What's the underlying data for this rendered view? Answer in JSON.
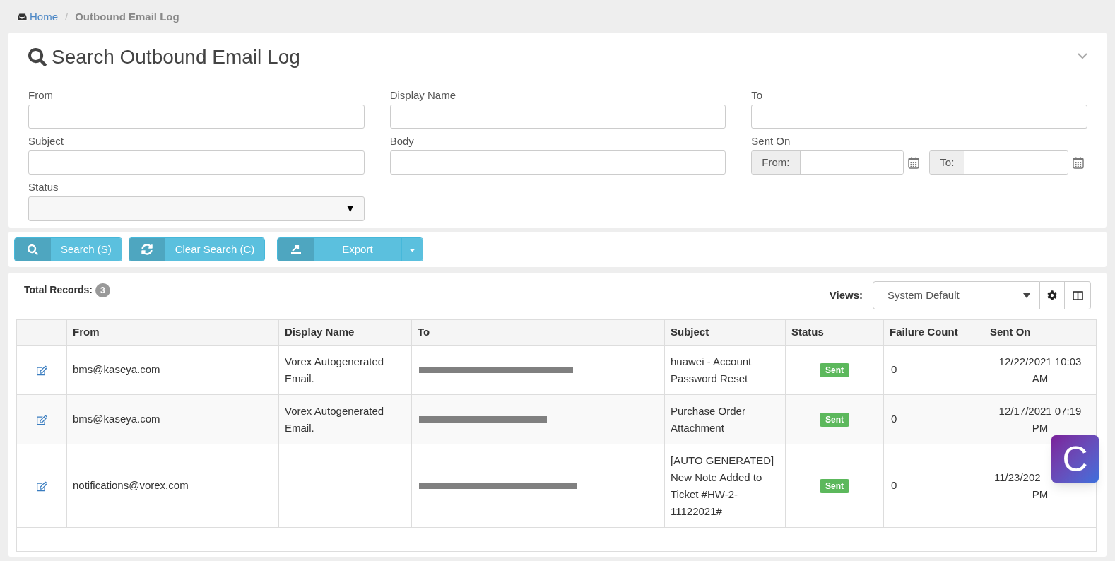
{
  "breadcrumb": [
    {
      "label": "Home",
      "kind": "link"
    },
    {
      "label": "Outbound Email Log",
      "kind": "current"
    }
  ],
  "breadcrumb_separator": "/",
  "status_caret": "▼",
  "search_panel": {
    "title": "Search Outbound Email Log",
    "fields": [
      {
        "label": "From",
        "kind": "text"
      },
      {
        "label": "Display Name",
        "kind": "text"
      },
      {
        "label": "To",
        "kind": "text"
      },
      {
        "label": "Subject",
        "kind": "text"
      },
      {
        "label": "Body",
        "kind": "text"
      },
      {
        "label": "Sent On",
        "kind": "date_range",
        "from_label": "From:",
        "to_label": "To:"
      },
      {
        "label": "Status",
        "kind": "select"
      }
    ]
  },
  "actions": [
    {
      "label": "Search (S)",
      "kind": "search"
    },
    {
      "label": "Clear Search (C)",
      "kind": "clear"
    },
    {
      "label": "Export",
      "kind": "export"
    }
  ],
  "results": {
    "total_label": "Total Records:",
    "total_count": "3",
    "views_label": "Views:",
    "view": "System Default",
    "columns": [
      "From",
      "Display Name",
      "To",
      "Subject",
      "Status",
      "Failure Count",
      "Sent On"
    ],
    "rows": [
      {
        "from": "bms@kaseya.com",
        "display_name": "Vorex Autogenerated Email.",
        "subject": "huawei - Account Password Reset",
        "status": "Sent",
        "failure_count": "0",
        "sent_on": [
          "12/22/2021 10:03",
          "AM"
        ]
      },
      {
        "from": "bms@kaseya.com",
        "display_name": "Vorex Autogenerated Email.",
        "subject": "Purchase Order Attachment",
        "status": "Sent",
        "failure_count": "0",
        "sent_on": [
          "12/17/2021 07:19",
          "PM"
        ]
      },
      {
        "from": "notifications@vorex.com",
        "subject": "[AUTO GENERATED] New Note Added to Ticket #HW-2-11122021#",
        "status": "Sent",
        "failure_count": "0",
        "sent_on": [
          "11/23/202",
          "PM"
        ]
      }
    ]
  },
  "chat_widget": {
    "letter": "C"
  }
}
